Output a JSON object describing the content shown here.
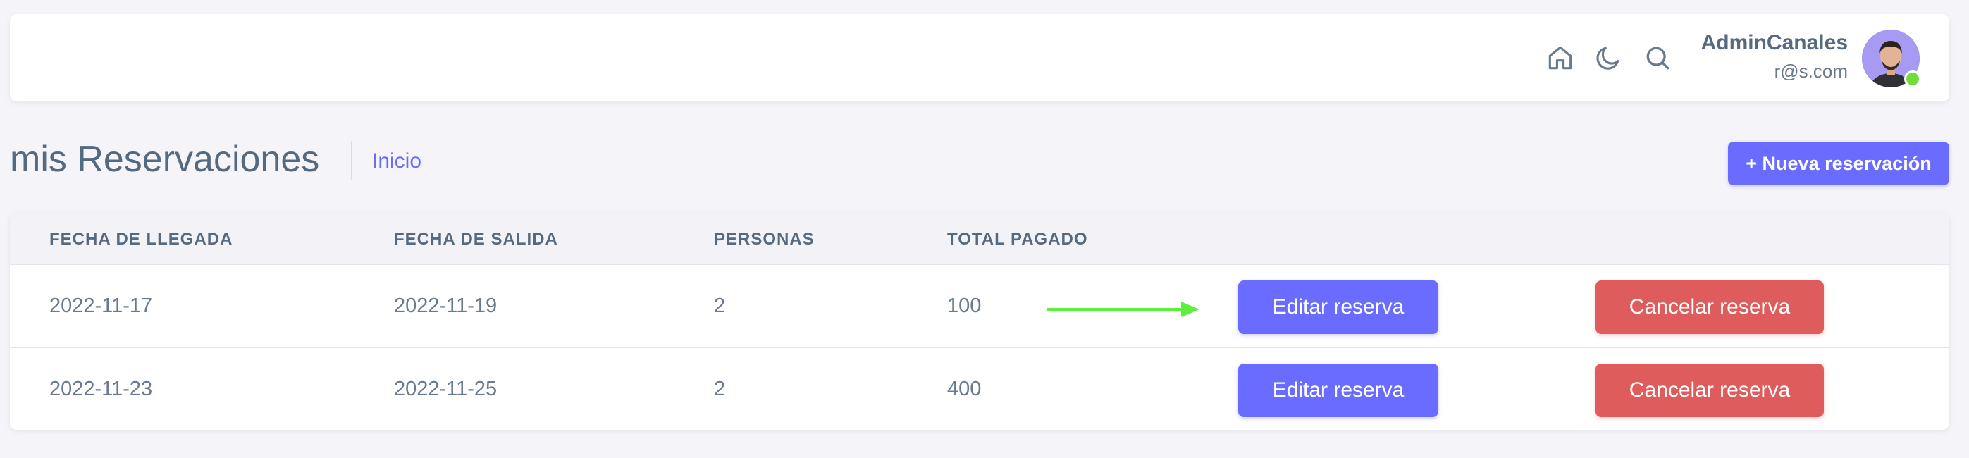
{
  "header": {
    "icons": [
      "home-icon",
      "moon-icon",
      "search-icon"
    ],
    "user": {
      "name": "AdminCanales",
      "email": "r@s.com"
    }
  },
  "page": {
    "title": "mis Reservaciones",
    "breadcrumb": "Inicio",
    "new_button_label": "+ Nueva reservación"
  },
  "table": {
    "columns": [
      "FECHA DE LLEGADA",
      "FECHA DE SALIDA",
      "PERSONAS",
      "TOTAL PAGADO"
    ],
    "rows": [
      {
        "arrival": "2022-11-17",
        "departure": "2022-11-19",
        "persons": "2",
        "total": "100",
        "edit_label": "Editar reserva",
        "cancel_label": "Cancelar reserva"
      },
      {
        "arrival": "2022-11-23",
        "departure": "2022-11-25",
        "persons": "2",
        "total": "400",
        "edit_label": "Editar reserva",
        "cancel_label": "Cancelar reserva"
      }
    ]
  },
  "colors": {
    "primary": "#696cff",
    "danger": "#df5c5c",
    "online": "#71dd37",
    "annotation_arrow": "#5cf03c"
  }
}
